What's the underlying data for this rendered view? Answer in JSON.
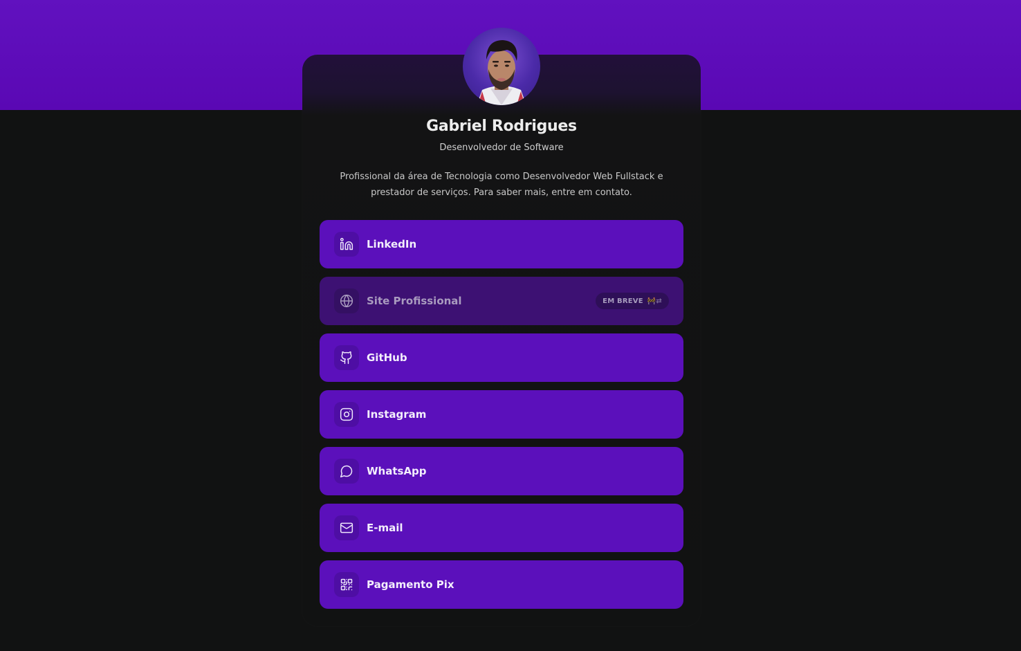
{
  "profile": {
    "name": "Gabriel Rodrigues",
    "role": "Desenvolvedor de Software",
    "bio": "Profissional da área de Tecnologia como Desenvolvedor Web Fullstack e prestador de serviços. Para saber mais, entre em contato."
  },
  "links": [
    {
      "label": "LinkedIn",
      "icon": "linkedin-icon"
    },
    {
      "label": "Site Profissional",
      "icon": "globe-icon",
      "badge": "EM BREVE",
      "badge_emoji": "🚧⇄",
      "disabled": true
    },
    {
      "label": "GitHub",
      "icon": "github-icon"
    },
    {
      "label": "Instagram",
      "icon": "instagram-icon"
    },
    {
      "label": "WhatsApp",
      "icon": "whatsapp-icon"
    },
    {
      "label": "E-mail",
      "icon": "mail-icon"
    },
    {
      "label": "Pagamento Pix",
      "icon": "qr-code-icon"
    }
  ],
  "colors": {
    "header_band": "#5f0fbe",
    "background": "#111212",
    "button": "#5b10bb",
    "button_disabled": "#3d1173",
    "text": "#ededed"
  }
}
